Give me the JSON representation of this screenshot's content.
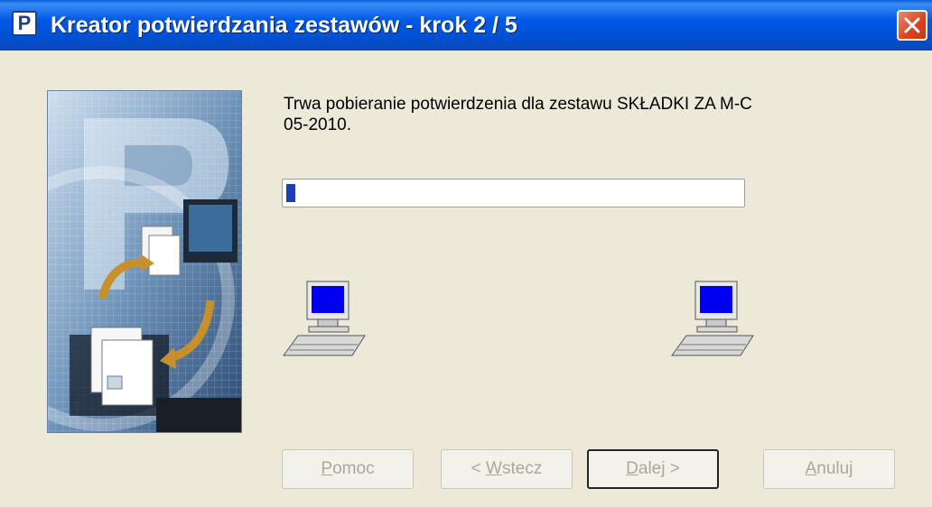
{
  "window": {
    "title": "Kreator potwierdzania zestawów - krok 2 / 5",
    "app_icon_letter": "P",
    "close_icon": "close-icon"
  },
  "main": {
    "message_line1": "Trwa pobieranie potwierdzenia dla zestawu SKŁADKI ZA M-C",
    "message_line2": "05-2010.",
    "progress_percent": 2
  },
  "buttons": {
    "help": {
      "first": "P",
      "rest": "omoc"
    },
    "back": {
      "pre": "< ",
      "first": "W",
      "rest": "stecz"
    },
    "next": {
      "first": "D",
      "rest": "alej >"
    },
    "cancel": {
      "first": "A",
      "rest": "nuluj"
    }
  },
  "colors": {
    "titlebar": "#0054e3",
    "progress_fill": "#1c3fb0",
    "dialog_bg": "#ece9d8",
    "close_button": "#d8431e"
  }
}
